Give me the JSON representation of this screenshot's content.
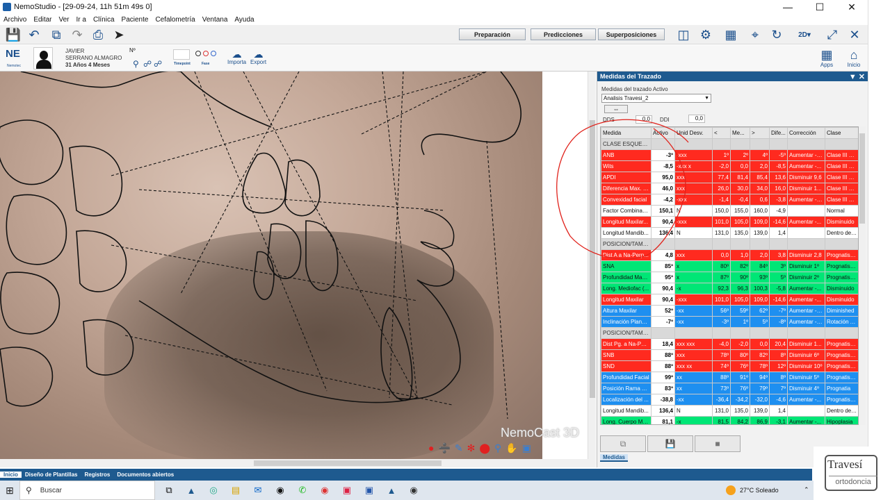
{
  "window": {
    "title": "NemoStudio - [29-09-24, 11h 51m 49s 0]"
  },
  "menu": [
    "Archivo",
    "Editar",
    "Ver",
    "Ir a",
    "Clínica",
    "Paciente",
    "Cefalometría",
    "Ventana",
    "Ayuda"
  ],
  "toolbar": {
    "preparacion": "Preparación",
    "predicciones": "Predicciones",
    "superposiciones": "Superposiciones",
    "view_2d": "2D"
  },
  "patient": {
    "logo": "NE",
    "logo_sub": "Nemotec",
    "first_name": "JAVIER",
    "last_name": "SERRANO ALMAGRO",
    "age": "31 Años 4 Meses",
    "number_label": "Nº",
    "timepoint_label": "Timepoint",
    "fase_label": "Fase",
    "import_label": "Importa",
    "export_label": "Export",
    "apps_label": "Apps",
    "inicio_label": "Inicio"
  },
  "image": {
    "watermark": "NemoCast 3D"
  },
  "panel": {
    "title": "Medidas del Trazado",
    "active_label": "Medidas del trazado Activo",
    "active_value": "Analisis Travesi_2",
    "dds_label": "DDS",
    "dds_value": "0,0",
    "ddi_label": "DDI",
    "ddi_value": "0,0",
    "tab_label": "Medidas",
    "columns": [
      "Medida",
      "Activo",
      "Unid Desv.",
      "<",
      "Me...",
      ">",
      "Dife...",
      "Corrección",
      "Clase"
    ],
    "rows": [
      {
        "type": "sec",
        "cells": [
          "CLASE ESQUELET...",
          "",
          "",
          "",
          "",
          "",
          "",
          "",
          ""
        ]
      },
      {
        "type": "red",
        "cells": [
          "ANB",
          "-3º",
          "-xxx",
          "1º",
          "2º",
          "4º",
          "-5º",
          "Aumentar - 4º",
          "Clase III Osea"
        ]
      },
      {
        "type": "red",
        "cells": [
          "Wits",
          "-8,5",
          "-xxx x",
          "-2,0",
          "0,0",
          "2,0",
          "-8,5",
          "Aumentar -...",
          "Clase III Osea"
        ]
      },
      {
        "type": "red",
        "cells": [
          "APDI",
          "95,0",
          "xxx",
          "77,4",
          "81,4",
          "85,4",
          "13,6",
          "Disminuir 9,6",
          "Clase III Osea"
        ]
      },
      {
        "type": "red",
        "cells": [
          "Diferencia Max. -...",
          "46,0",
          "xxx",
          "26,0",
          "30,0",
          "34,0",
          "16,0",
          "Disminuir 1...",
          "Clase III Osea"
        ]
      },
      {
        "type": "red",
        "cells": [
          "Convexidad facial",
          "-4,2",
          "-xxx",
          "-1,4",
          "-0,4",
          "0,6",
          "-3,8",
          "Aumentar - 3...",
          "Clase III Osea"
        ]
      },
      {
        "type": "white",
        "cells": [
          "Factor Combinac...",
          "150,1",
          "N",
          "150,0",
          "155,0",
          "160,0",
          "-4,9",
          "",
          "Normal"
        ]
      },
      {
        "type": "red",
        "cells": [
          "Longitud Maxilar...",
          "90,4",
          "-xxx",
          "101,0",
          "105,0",
          "109,0",
          "-14,6",
          "Aumentar -...",
          "Disminuido"
        ]
      },
      {
        "type": "white",
        "cells": [
          "Longitud Mandib...",
          "136,4",
          "N",
          "131,0",
          "135,0",
          "139,0",
          "1,4",
          "",
          "Dentro de N..."
        ]
      },
      {
        "type": "sec",
        "cells": [
          "POSICION/TAMA...",
          "",
          "",
          "",
          "",
          "",
          "",
          "",
          ""
        ]
      },
      {
        "type": "red",
        "cells": [
          "Dist A a Na-Perp...",
          "4,8",
          "xxx",
          "0,0",
          "1,0",
          "2,0",
          "3,8",
          "Disminuir 2,8",
          "Prognatism..."
        ]
      },
      {
        "type": "green",
        "cells": [
          "SNA",
          "85º",
          "x",
          "80º",
          "82º",
          "84º",
          "3º",
          "Disminuir 1º",
          "Prognatism..."
        ]
      },
      {
        "type": "green",
        "cells": [
          "Profundidad Max...",
          "95º",
          "x",
          "87º",
          "90º",
          "93º",
          "5º",
          "Disminuir 2º",
          "Prognatism..."
        ]
      },
      {
        "type": "green",
        "cells": [
          "Long. Mediofac (...",
          "90,4",
          "-x",
          "92,3",
          "96,3",
          "100,3",
          "-5,8",
          "Aumentar -...",
          "Disminuido"
        ]
      },
      {
        "type": "red",
        "cells": [
          "Longitud Maxilar",
          "90,4",
          "-xxx",
          "101,0",
          "105,0",
          "109,0",
          "-14,6",
          "Aumentar -...",
          "Disminuido"
        ]
      },
      {
        "type": "blue",
        "cells": [
          "Altura Maxilar",
          "52º",
          "-xx",
          "56º",
          "59º",
          "62º",
          "-7º",
          "Aumentar - 4º",
          "Diminished"
        ]
      },
      {
        "type": "blue",
        "cells": [
          "Inclinación Plano...",
          "-7º",
          "-xx",
          "-3º",
          "1º",
          "5º",
          "-8º",
          "Aumentar - 4º",
          "Rotación An..."
        ]
      },
      {
        "type": "sec",
        "cells": [
          "POSICION/TAMA...",
          "",
          "",
          "",
          "",
          "",
          "",
          "",
          ""
        ]
      },
      {
        "type": "red",
        "cells": [
          "Dist Pg. a Na-Per...",
          "18,4",
          "xxx xxx",
          "-4,0",
          "-2,0",
          "0,0",
          "20,4",
          "Disminuir 1...",
          "Prognatism..."
        ]
      },
      {
        "type": "red",
        "cells": [
          "SNB",
          "88º",
          "xxx",
          "78º",
          "80º",
          "82º",
          "8º",
          "Disminuir 6º",
          "Prognatism..."
        ]
      },
      {
        "type": "red",
        "cells": [
          "SND",
          "88º",
          "xxx xx",
          "74º",
          "76º",
          "78º",
          "12º",
          "Disminuir 10º",
          "Prognatism..."
        ]
      },
      {
        "type": "blue",
        "cells": [
          "Profundidad Facial",
          "99º",
          "xx",
          "88º",
          "91º",
          "94º",
          "8º",
          "Disminuir 5º",
          "Prognatism..."
        ]
      },
      {
        "type": "blue",
        "cells": [
          "Posición Rama A...",
          "83º",
          "xx",
          "73º",
          "76º",
          "79º",
          "7º",
          "Disminuir 4º",
          "Prognatia"
        ]
      },
      {
        "type": "blue",
        "cells": [
          "Localización del ...",
          "-38,8",
          "-xx",
          "-36,4",
          "-34,2",
          "-32,0",
          "-4,6",
          "Aumentar -...",
          "Prognatism..."
        ]
      },
      {
        "type": "white",
        "cells": [
          "Longitud Mandib...",
          "136,4",
          "N",
          "131,0",
          "135,0",
          "139,0",
          "1,4",
          "",
          "Dentro de N..."
        ]
      },
      {
        "type": "green",
        "cells": [
          "Long. Cuerpo Ma...",
          "81,1",
          "-x",
          "81,5",
          "84,2",
          "86,9",
          "-3,1",
          "Aumentar -...",
          "Hipoplasia"
        ]
      }
    ]
  },
  "statusbar": [
    "Inicio",
    "Diseño de Plantillas",
    "Registros",
    "Documentos abiertos"
  ],
  "logo": {
    "line1": "Travesí",
    "line2": "ortodoncia"
  },
  "taskbar": {
    "search_placeholder": "Buscar",
    "weather": "27°C  Soleado"
  },
  "colors": {
    "header_blue": "#1e5a8f",
    "row_red": "#ff2a1f",
    "row_green": "#00e676",
    "row_blue": "#1e8ff0",
    "annotation": "#e0221b"
  }
}
